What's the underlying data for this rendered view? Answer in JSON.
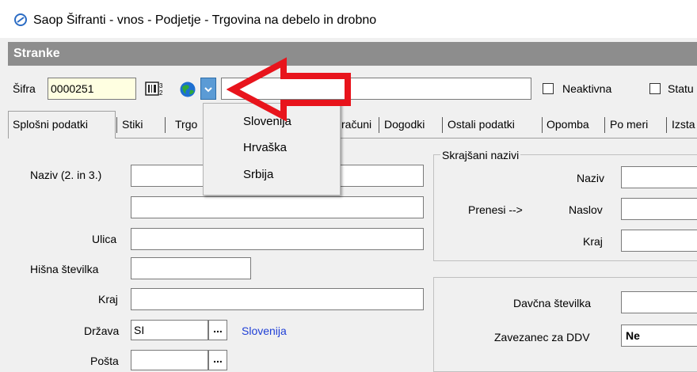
{
  "window": {
    "title": "Saop Šifranti - vnos - Podjetje - Trgovina na debelo in drobno"
  },
  "app": {
    "header": "Stranke"
  },
  "top": {
    "sifra_label": "Šifra",
    "sifra_value": "0000251",
    "neaktivna_label": "Neaktivna",
    "status_label": "Statu"
  },
  "tabs": [
    "Splošni podatki",
    "Stiki",
    "Trgo",
    "računi",
    "Dogodki",
    "Ostali podatki",
    "Opomba",
    "Po meri",
    "Izsta"
  ],
  "dropdown": {
    "options": [
      "Slovenija",
      "Hrvaška",
      "Srbija"
    ]
  },
  "form": {
    "naziv_label": "Naziv (2. in 3.)",
    "ulica_label": "Ulica",
    "hisna_label": "Hišna številka",
    "kraj_label": "Kraj",
    "drzava_label": "Država",
    "drzava_value": "SI",
    "drzava_name": "Slovenija",
    "posta_label": "Pošta"
  },
  "short_names": {
    "title": "Skrajšani nazivi",
    "naziv_label": "Naziv",
    "naslov_label": "Naslov",
    "kraj_label": "Kraj",
    "prenesi_label": "Prenesi -->"
  },
  "tax": {
    "davcna_label": "Davčna številka",
    "zavezanec_label": "Zavezanec za DDV",
    "zavezanec_value": "Ne"
  },
  "colors": {
    "arrow": "#e8141c",
    "link": "#1f3fd6",
    "dropdown_btn": "#5b9bd5",
    "sifra_bg": "#ffffe1"
  },
  "icons": [
    "app-logo-icon",
    "barcode-icon",
    "globe-icon",
    "chevron-down-icon",
    "annotation-arrow-icon"
  ]
}
